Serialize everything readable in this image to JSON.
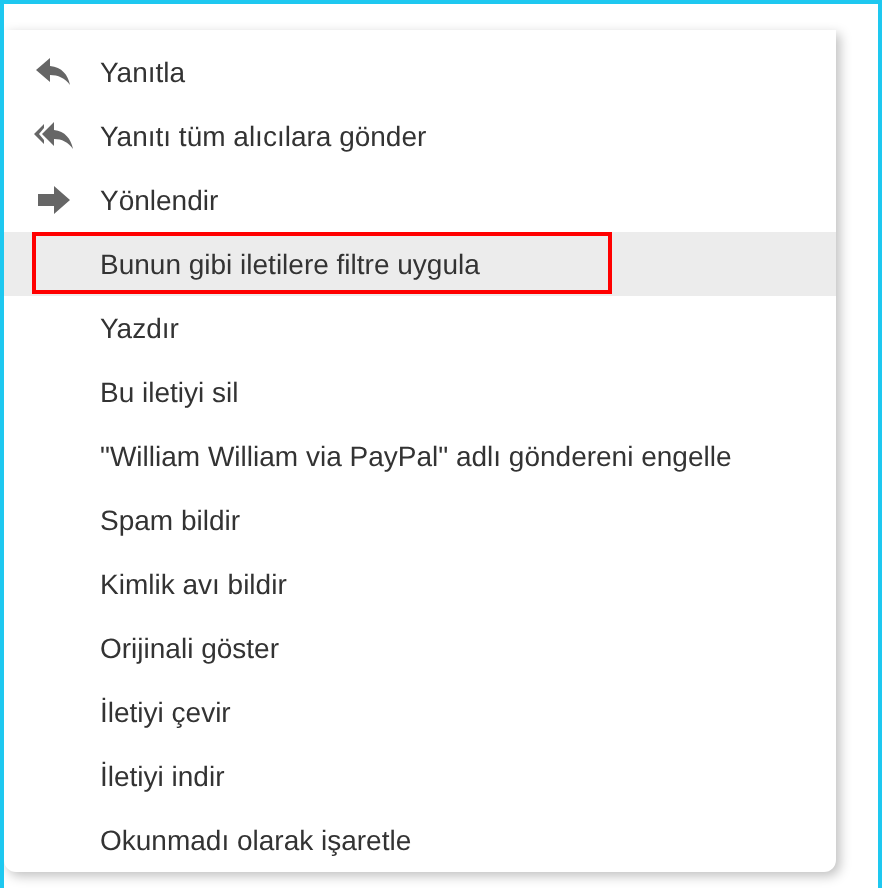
{
  "menu": {
    "items": [
      {
        "kind": "reply",
        "label": "Yanıtla",
        "selected": false,
        "outlined": false
      },
      {
        "kind": "reply_all",
        "label": "Yanıtı tüm alıcılara gönder",
        "selected": false,
        "outlined": false
      },
      {
        "kind": "forward",
        "label": "Yönlendir",
        "selected": false,
        "outlined": false
      },
      {
        "kind": "plain",
        "label": "Bunun gibi iletilere filtre uygula",
        "selected": true,
        "outlined": true
      },
      {
        "kind": "plain",
        "label": "Yazdır",
        "selected": false,
        "outlined": false
      },
      {
        "kind": "plain",
        "label": "Bu iletiyi sil",
        "selected": false,
        "outlined": false
      },
      {
        "kind": "plain",
        "label": "\"William William via PayPal\" adlı göndereni engelle",
        "selected": false,
        "outlined": false
      },
      {
        "kind": "plain",
        "label": "Spam bildir",
        "selected": false,
        "outlined": false
      },
      {
        "kind": "plain",
        "label": "Kimlik avı bildir",
        "selected": false,
        "outlined": false
      },
      {
        "kind": "plain",
        "label": "Orijinali göster",
        "selected": false,
        "outlined": false
      },
      {
        "kind": "plain",
        "label": "İletiyi çevir",
        "selected": false,
        "outlined": false
      },
      {
        "kind": "plain",
        "label": "İletiyi indir",
        "selected": false,
        "outlined": false
      },
      {
        "kind": "plain",
        "label": "Okunmadı olarak işaretle",
        "selected": false,
        "outlined": false
      }
    ]
  }
}
